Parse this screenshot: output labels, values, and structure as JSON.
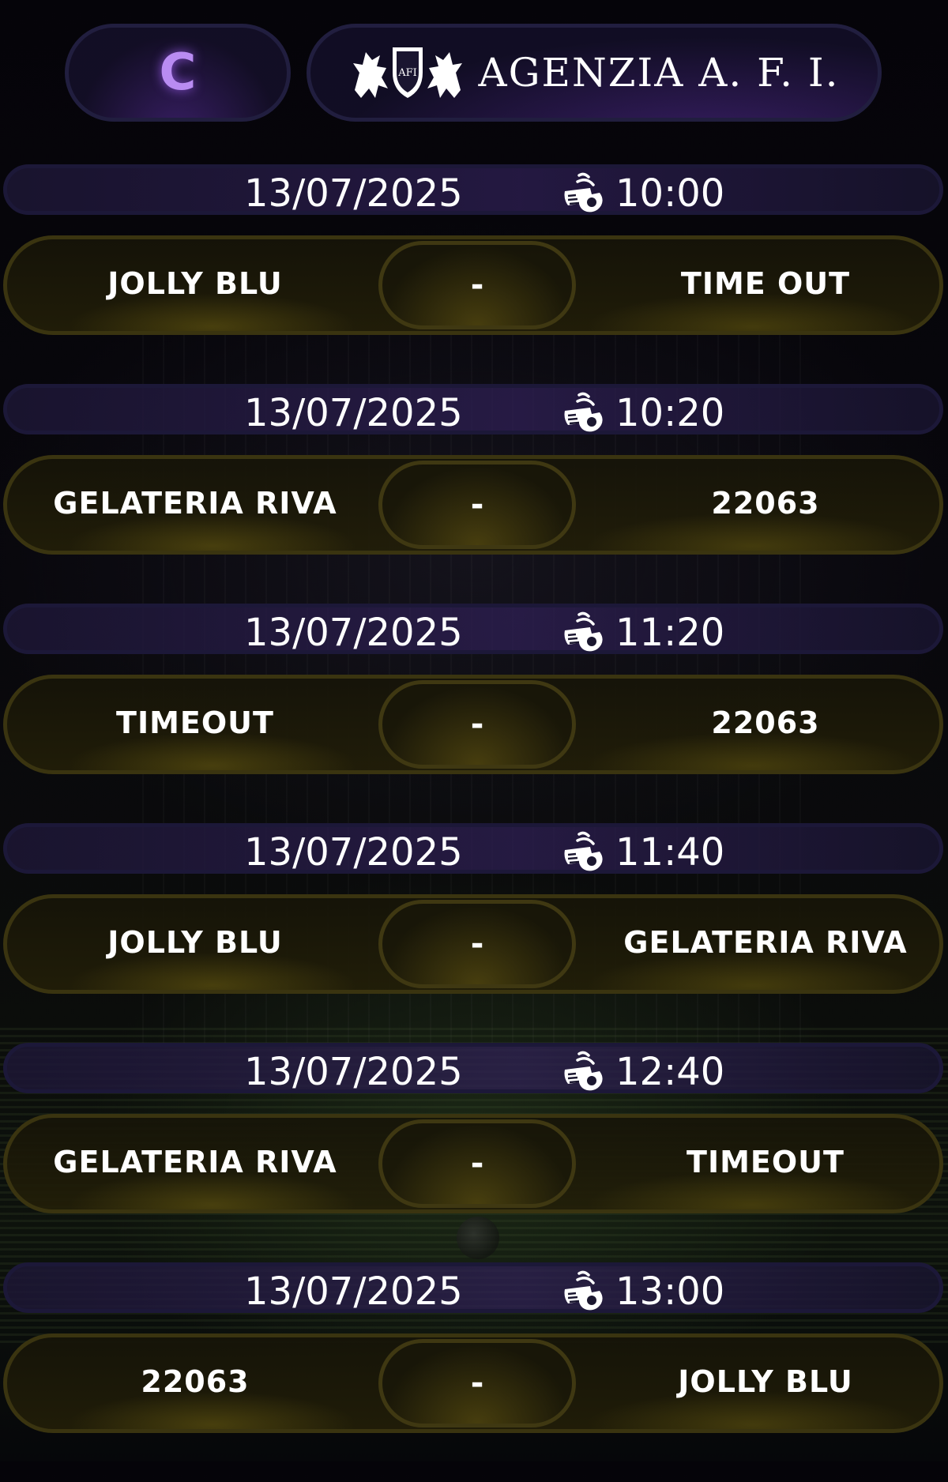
{
  "header": {
    "category_letter": "C",
    "brand_name": "AGENZIA A. F. I.",
    "crest_text": "AFI"
  },
  "matches": [
    {
      "date": "13/07/2025",
      "time": "10:00",
      "home": "JOLLY BLU",
      "separator": "-",
      "away": "TIME OUT"
    },
    {
      "date": "13/07/2025",
      "time": "10:20",
      "home": "GELATERIA RIVA",
      "separator": "-",
      "away": "22063"
    },
    {
      "date": "13/07/2025",
      "time": "11:20",
      "home": "TIMEOUT",
      "separator": "-",
      "away": "22063"
    },
    {
      "date": "13/07/2025",
      "time": "11:40",
      "home": "JOLLY BLU",
      "separator": "-",
      "away": "GELATERIA RIVA"
    },
    {
      "date": "13/07/2025",
      "time": "12:40",
      "home": "GELATERIA RIVA",
      "separator": "-",
      "away": "TIMEOUT"
    },
    {
      "date": "13/07/2025",
      "time": "13:00",
      "home": "22063",
      "separator": "-",
      "away": "JOLLY BLU"
    }
  ],
  "icons": {
    "whistle": "whistle-icon",
    "crest": "griffin-crest-icon"
  },
  "colors": {
    "accent_purple": "#b98cf2",
    "date_bar_border": "#1c1838",
    "teams_bar_border": "#3a3410"
  }
}
